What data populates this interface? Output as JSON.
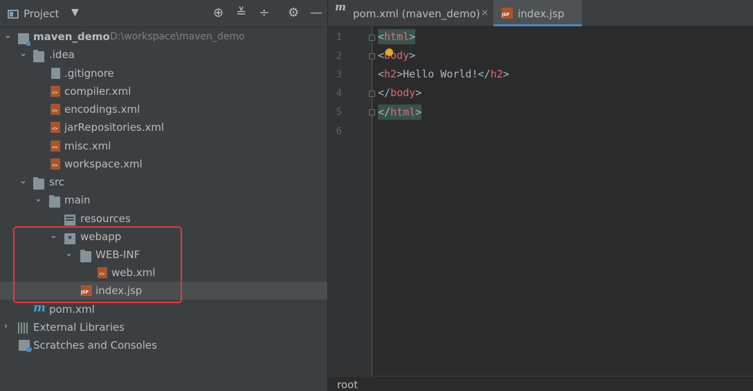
{
  "project_panel": {
    "title": "Project",
    "dropdown_glyph": "▼",
    "toolbar_icons": [
      "crosshair-icon",
      "collapse-all-icon",
      "expand-icon",
      "gear-icon",
      "minimize-icon"
    ]
  },
  "tree": {
    "root": {
      "name": "maven_demo",
      "path": "D:\\workspace\\maven_demo"
    },
    "idea": ".idea",
    "idea_files": [
      ".gitignore",
      "compiler.xml",
      "encodings.xml",
      "jarRepositories.xml",
      "misc.xml",
      "workspace.xml"
    ],
    "src": "src",
    "main": "main",
    "resources": "resources",
    "webapp": "webapp",
    "webinf": "WEB-INF",
    "webxml": "web.xml",
    "indexjsp": "index.jsp",
    "pom": "pom.xml",
    "external_libraries": "External Libraries",
    "scratches": "Scratches and Consoles"
  },
  "editor": {
    "tabs": [
      {
        "label": "pom.xml (maven_demo)",
        "icon": "maven-icon",
        "active": false
      },
      {
        "label": "index.jsp",
        "icon": "jsp-file-icon",
        "active": true
      }
    ],
    "line_numbers": [
      "1",
      "2",
      "3",
      "4",
      "5",
      "6"
    ],
    "code": {
      "l1": {
        "open": "<",
        "name": "html",
        "close": ">"
      },
      "l2": {
        "open": "<",
        "name": "body",
        "close": ">"
      },
      "l3": {
        "open": "<",
        "name": "h2",
        "close": ">",
        "text": "Hello World!",
        "endopen": "</",
        "endname": "h2",
        "endclose": ">"
      },
      "l4": {
        "open": "</",
        "name": "body",
        "close": ">"
      },
      "l5": {
        "open": "</",
        "name": "html",
        "close": ">"
      }
    },
    "breadcrumb": "root"
  },
  "colors": {
    "panel_bg": "#3c3f41",
    "editor_bg": "#2b2b2b",
    "selection_bg": "#4b4d4f",
    "highlight_box": "#e23b3b",
    "tag_name": "#e06c75",
    "accent": "#4a88c7"
  }
}
